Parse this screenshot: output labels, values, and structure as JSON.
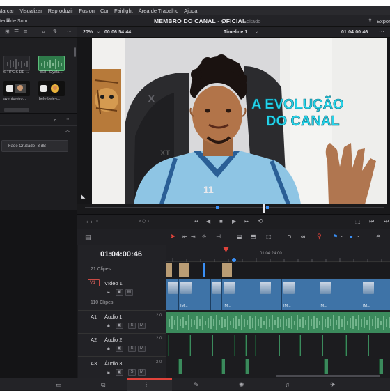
{
  "menu": [
    "Marcar",
    "Visualizar",
    "Reproduzir",
    "Fusion",
    "Cor",
    "Fairlight",
    "Área de Trabalho",
    "Ajuda"
  ],
  "project": {
    "left_label": "teca de Som",
    "title": "MEMBRO DO CANAL - ØFICIAL",
    "status": "Editado",
    "right_label": "Expor"
  },
  "viewer": {
    "zoom": "20%",
    "source_tc": "00:06:54:44",
    "timeline_name": "Timeline 1",
    "record_tc": "01:04:00:46"
  },
  "video_text": {
    "line1": "A EVOLUÇÃO",
    "line2": "DO CANAL"
  },
  "media_pool": {
    "items": [
      {
        "label": "6 TIPOS DE ..."
      },
      {
        "label": "368 - Dyala..."
      },
      {
        "label": "aventureiro..."
      },
      {
        "label": "bele-bele-r..."
      }
    ]
  },
  "effects": {
    "item": "Fade Cruzado -3 dB"
  },
  "timeline": {
    "timecode": "01:04:00:46",
    "ruler_label": "01:04:24:00",
    "tracks": [
      {
        "id": "V1",
        "name": "Vídeo 1",
        "sub": "110 Clipes",
        "above": "21 Clipes"
      },
      {
        "id": "A1",
        "name": "Áudio 1",
        "level": "2.0"
      },
      {
        "id": "A2",
        "name": "Áudio 2",
        "level": "2.0"
      },
      {
        "id": "A3",
        "name": "Áudio 3",
        "level": "2.0"
      }
    ],
    "clip_label": "IM..."
  },
  "colors": {
    "accent_red": "#e0433b",
    "accent_blue": "#3a8ff5",
    "video_clip": "#3e73a7",
    "audio_clip": "#3b8a5c",
    "title_text": "#25d4ea"
  }
}
